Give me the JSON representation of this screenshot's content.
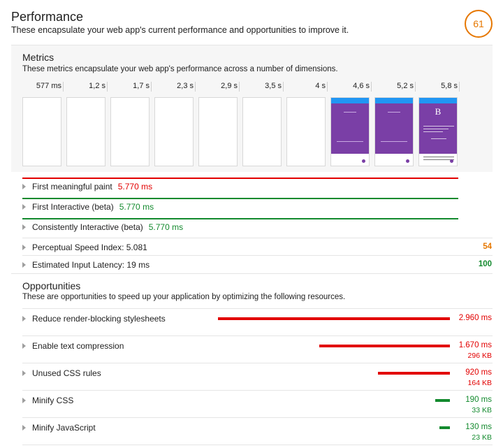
{
  "performance": {
    "title": "Performance",
    "description": "These encapsulate your web app's current performance and opportunities to improve it.",
    "score": "61",
    "score_color": "#e67700"
  },
  "metrics": {
    "title": "Metrics",
    "description": "These metrics encapsulate your web app's performance across a number of dimensions.",
    "timeline_ticks": [
      "577 ms",
      "1,2 s",
      "1,7 s",
      "2,3 s",
      "2,9 s",
      "3,5 s",
      "4 s",
      "4,6 s",
      "5,2 s",
      "5,8 s"
    ],
    "frames": [
      "blank",
      "blank",
      "blank",
      "blank",
      "blank",
      "blank",
      "blank",
      "app-loading",
      "app-loading",
      "app-content"
    ],
    "frame_letter": "B",
    "rows": [
      {
        "label": "First meaningful paint",
        "value": "5.770 ms",
        "status": "red"
      },
      {
        "label": "First Interactive (beta)",
        "value": "5.770 ms",
        "status": "green"
      },
      {
        "label": "Consistently Interactive (beta)",
        "value": "5.770 ms",
        "status": "green"
      },
      {
        "label": "Perceptual Speed Index: 5.081",
        "score": "54",
        "score_color": "#e67700"
      },
      {
        "label": "Estimated Input Latency: 19 ms",
        "score": "100",
        "score_color": "#138a2e"
      }
    ]
  },
  "opportunities": {
    "title": "Opportunities",
    "description": "These are opportunities to speed up your application by optimizing the following resources.",
    "items": [
      {
        "label": "Reduce render-blocking stylesheets",
        "value": "2.960 ms",
        "size": "",
        "color": "#e20000",
        "fraction": 1.0
      },
      {
        "label": "Enable text compression",
        "value": "1.670 ms",
        "size": "296 KB",
        "color": "#e20000",
        "fraction": 0.564
      },
      {
        "label": "Unused CSS rules",
        "value": "920 ms",
        "size": "164 KB",
        "color": "#e20000",
        "fraction": 0.311
      },
      {
        "label": "Minify CSS",
        "value": "190 ms",
        "size": "33 KB",
        "color": "#138a2e",
        "fraction": 0.064
      },
      {
        "label": "Minify JavaScript",
        "value": "130 ms",
        "size": "23 KB",
        "color": "#138a2e",
        "fraction": 0.044
      }
    ]
  },
  "colors": {
    "red": "#e20000",
    "green": "#138a2e",
    "orange": "#e67700"
  }
}
